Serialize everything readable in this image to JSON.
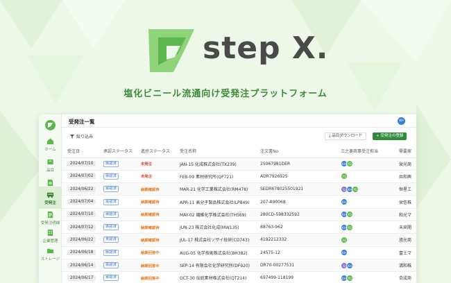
{
  "brand": {
    "name": "step X.",
    "tagline": "塩化ビニール流通向け受発注プラットフォーム"
  },
  "colors": {
    "accent": "#2f8a3a",
    "brand_green": "#5cb84c",
    "status_red": "#d6452f",
    "approval_blue": "#3a72c0"
  },
  "sidebar": {
    "items": [
      {
        "label": "ホーム",
        "icon": "home-icon"
      },
      {
        "label": "品目",
        "icon": "box-icon"
      },
      {
        "label": "見積",
        "icon": "document-icon"
      },
      {
        "label": "受発注",
        "icon": "truck-icon",
        "active": true
      },
      {
        "label": "受発注明細",
        "icon": "list-document-icon"
      },
      {
        "label": "企業管理",
        "icon": "building-icon"
      },
      {
        "label": "ストレージ",
        "icon": "folder-icon"
      }
    ]
  },
  "header": {
    "title": "受発注一覧",
    "user_initials": "KH"
  },
  "toolbar": {
    "filter_label": "絞り込み",
    "download_label": "品目ダウンロード",
    "register_label": "+ 受発注の登録"
  },
  "table": {
    "columns": [
      "受注日",
      "承認ステータス",
      "進捗ステータス",
      "受注名称",
      "注文書No.",
      "三之菱商事受注担当",
      "需要家"
    ],
    "rows": [
      {
        "date": "2024/07/10",
        "approval": "承認済",
        "status": "未発注",
        "name": "JAN-15 化成株式会社(TX239)",
        "order_no": "25067981DER",
        "reps": [
          "KH",
          "YO"
        ],
        "customer": "栄光商"
      },
      {
        "date": "2024/07/02",
        "approval": "承認済",
        "status": "未発注",
        "name": "FEB-09 素材研究所(QF721)",
        "order_no": "ADR7926925",
        "reps": [
          "YO"
        ],
        "customer": "共和興"
      },
      {
        "date": "2024/06/22",
        "approval": "承認済",
        "status": "納期確認待",
        "name": "MAR-21 化学工業株式会社(RM478)",
        "order_no": "SEDR67802550192​1",
        "reps": [
          "SJ",
          "KH",
          "YO"
        ],
        "customer": "恒星エ"
      },
      {
        "date": "2024/07/04",
        "approval": "承認済",
        "status": "納期確認待",
        "name": "APR-11 高分子製品株式会社(LP849)",
        "order_no": "207-A90068",
        "reps": [
          "KH"
        ],
        "customer": "栄信株"
      },
      {
        "date": "2024/07/10",
        "approval": "承認済",
        "status": "納期確認待",
        "name": "MAY-02 繊維化学株式会社(TH569)",
        "order_no": "280CD-598332592",
        "reps": [
          "KH",
          "YO"
        ],
        "customer": "和光マ"
      },
      {
        "date": "2024/07/12",
        "approval": "承認済",
        "status": "納期確認待",
        "name": "JUN-23 株式会社化成(MW135)",
        "order_no": "88763-962",
        "reps": [
          "KH",
          "YO"
        ],
        "customer": "未来開"
      },
      {
        "date": "2024/06/22",
        "approval": "未認済",
        "status": "納期確認待",
        "name": "JUL-17 株式会社ソザイ技研(CD743)",
        "order_no": "4192212332",
        "reps": [
          "YO"
        ],
        "customer": "旭光商"
      },
      {
        "date": "2024/06/18",
        "approval": "承認済",
        "status": "納期回答中",
        "name": "AUG-05 化学技術株式会社(BH382)",
        "order_no": "24575-12",
        "reps": [
          "KH"
        ],
        "customer": "富士マ"
      },
      {
        "date": "2024/06/14",
        "approval": "承認済",
        "status": "納期回答中",
        "name": "SEP-14 有限会社化学研究所(DF920)",
        "order_no": "DR70-00277531",
        "reps": [
          "SJ",
          "KH"
        ],
        "customer": "満和株"
      },
      {
        "date": "2024/06/17",
        "approval": "承認済",
        "status": "納期回答中",
        "name": "OCT-30 伝統素材株式会社(QT214)",
        "order_no": "697499-118199",
        "reps": [
          "KH",
          "YO"
        ],
        "customer": "合成商"
      }
    ]
  }
}
